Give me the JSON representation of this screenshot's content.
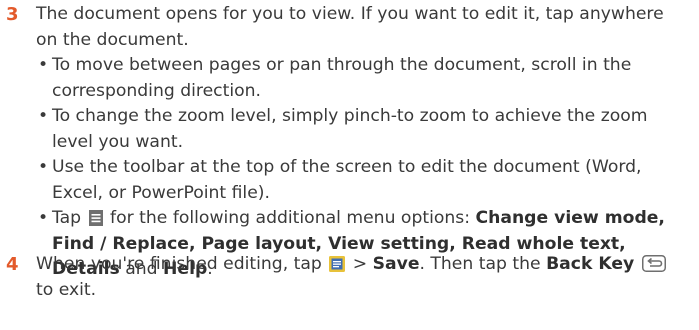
{
  "step3": {
    "number": "3",
    "text": "The document opens for you to view. If you want to edit it, tap anywhere on the document.",
    "bullets": [
      {
        "text": "To move between pages or pan through the document, scroll in the corresponding direction."
      },
      {
        "text": "To change the zoom level, simply pinch-to zoom to achieve the zoom level you want."
      },
      {
        "text": "Use the toolbar at the top of the screen to edit the document (Word, Excel, or PowerPoint file)."
      },
      {
        "tap": "Tap",
        "after_icon": "for the following additional menu options:",
        "options": "Change view mode, Find / Replace, Page layout, View setting, Read whole text, Details",
        "and": "and",
        "last_option": "Help",
        "period": ".",
        "icon": "menu-icon"
      }
    ]
  },
  "step4": {
    "number": "4",
    "before_icon": "When you're finished editing, tap",
    "word_icon": "word-save-icon",
    "gt": ">",
    "save": "Save",
    "then": ". Then tap the",
    "back_key": "Back Key",
    "back_icon": "back-key-icon",
    "to_exit": "to exit."
  },
  "colors": {
    "step_number": "#e35a2b",
    "body_text": "#3a3a3a",
    "icon_gray": "#6f6f6f",
    "word_icon_bg": "#e8c23a",
    "word_icon_fg": "#3f6db4"
  }
}
